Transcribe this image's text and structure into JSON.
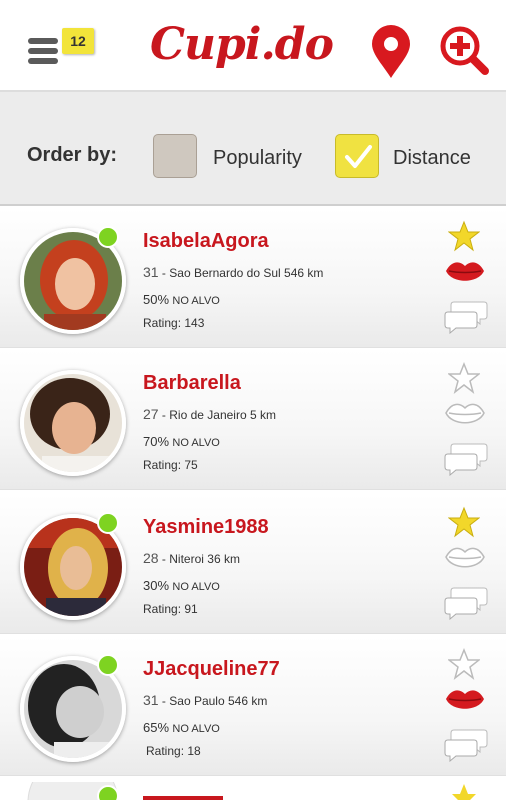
{
  "header": {
    "logo_text": "Cupi.do",
    "notification_count": "12",
    "icons": [
      "menu-icon",
      "location-pin-icon",
      "add-search-icon"
    ]
  },
  "order_bar": {
    "label": "Order by:",
    "options": [
      {
        "label": "Popularity",
        "checked": false
      },
      {
        "label": "Distance",
        "checked": true
      }
    ]
  },
  "colors": {
    "brand_red": "#c8171e",
    "online_green": "#7ed321",
    "star_yellow": "#f2d72a",
    "check_yellow": "#f0e241"
  },
  "profiles": [
    {
      "name": "IsabelaAgora",
      "age": "31",
      "city": "Sao Bernardo do Sul",
      "distance": "546 km",
      "match_pct": "50%",
      "match_label": "NO ALVO",
      "rating": "Rating: 143",
      "online": true,
      "starred": true,
      "kissed": true
    },
    {
      "name": "Barbarella",
      "age": "27",
      "city": "Rio de Janeiro",
      "distance": "5 km",
      "match_pct": "70%",
      "match_label": "NO ALVO",
      "rating": "Rating: 75",
      "online": false,
      "starred": false,
      "kissed": false
    },
    {
      "name": "Yasmine1988",
      "age": "28",
      "city": "Niteroi",
      "distance": "36 km",
      "match_pct": "30%",
      "match_label": "NO ALVO",
      "rating": "Rating: 91",
      "online": true,
      "starred": true,
      "kissed": false
    },
    {
      "name": "JJacqueline77",
      "age": "31",
      "city": "Sao Paulo",
      "distance": "546 km",
      "match_pct": "65%",
      "match_label": "NO ALVO",
      "rating": "Rating: 18",
      "online": true,
      "starred": false,
      "kissed": true
    }
  ]
}
